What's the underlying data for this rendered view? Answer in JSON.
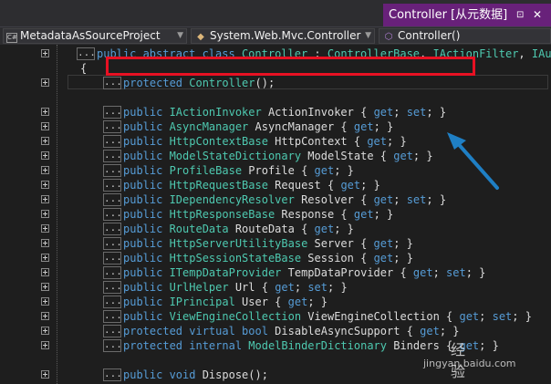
{
  "tab": {
    "title": "Controller [从元数据]",
    "pin_glyph": "⊡",
    "close_glyph": "✕"
  },
  "navbar": {
    "project": "MetadataAsSourceProject",
    "class": "System.Web.Mvc.Controller",
    "member": "Controller()"
  },
  "code_lines": [
    {
      "fold": true,
      "ell": true,
      "parts": [
        [
          "kw",
          "public abstract class "
        ],
        [
          "ty",
          "Controller"
        ],
        [
          "pl",
          " : "
        ],
        [
          "ty",
          "ControllerBase"
        ],
        [
          "pl",
          ", "
        ],
        [
          "ty",
          "IActionFilter"
        ],
        [
          "pl",
          ", "
        ],
        [
          "ty",
          "IAuth"
        ]
      ]
    },
    {
      "fold": false,
      "ell": false,
      "parts": [
        [
          "pl",
          "{"
        ]
      ]
    },
    {
      "fold": true,
      "ell": true,
      "parts": [
        [
          "kw",
          "protected "
        ],
        [
          "ty",
          "Controller"
        ],
        [
          "pl",
          "();"
        ]
      ]
    },
    {
      "fold": false,
      "ell": false,
      "parts": []
    },
    {
      "fold": true,
      "ell": true,
      "parts": [
        [
          "kw",
          "public "
        ],
        [
          "ty",
          "IActionInvoker"
        ],
        [
          "pl",
          " ActionInvoker { "
        ],
        [
          "kw",
          "get"
        ],
        [
          "pl",
          "; "
        ],
        [
          "kw",
          "set"
        ],
        [
          "pl",
          "; }"
        ]
      ]
    },
    {
      "fold": true,
      "ell": true,
      "parts": [
        [
          "kw",
          "public "
        ],
        [
          "ty",
          "AsyncManager"
        ],
        [
          "pl",
          " AsyncManager { "
        ],
        [
          "kw",
          "get"
        ],
        [
          "pl",
          "; }"
        ]
      ]
    },
    {
      "fold": true,
      "ell": true,
      "parts": [
        [
          "kw",
          "public "
        ],
        [
          "ty",
          "HttpContextBase"
        ],
        [
          "pl",
          " HttpContext { "
        ],
        [
          "kw",
          "get"
        ],
        [
          "pl",
          "; }"
        ]
      ]
    },
    {
      "fold": true,
      "ell": true,
      "parts": [
        [
          "kw",
          "public "
        ],
        [
          "ty",
          "ModelStateDictionary"
        ],
        [
          "pl",
          " ModelState { "
        ],
        [
          "kw",
          "get"
        ],
        [
          "pl",
          "; }"
        ]
      ]
    },
    {
      "fold": true,
      "ell": true,
      "parts": [
        [
          "kw",
          "public "
        ],
        [
          "ty",
          "ProfileBase"
        ],
        [
          "pl",
          " Profile { "
        ],
        [
          "kw",
          "get"
        ],
        [
          "pl",
          "; }"
        ]
      ]
    },
    {
      "fold": true,
      "ell": true,
      "parts": [
        [
          "kw",
          "public "
        ],
        [
          "ty",
          "HttpRequestBase"
        ],
        [
          "pl",
          " Request { "
        ],
        [
          "kw",
          "get"
        ],
        [
          "pl",
          "; }"
        ]
      ]
    },
    {
      "fold": true,
      "ell": true,
      "parts": [
        [
          "kw",
          "public "
        ],
        [
          "ty",
          "IDependencyResolver"
        ],
        [
          "pl",
          " Resolver { "
        ],
        [
          "kw",
          "get"
        ],
        [
          "pl",
          "; "
        ],
        [
          "kw",
          "set"
        ],
        [
          "pl",
          "; }"
        ]
      ]
    },
    {
      "fold": true,
      "ell": true,
      "parts": [
        [
          "kw",
          "public "
        ],
        [
          "ty",
          "HttpResponseBase"
        ],
        [
          "pl",
          " Response { "
        ],
        [
          "kw",
          "get"
        ],
        [
          "pl",
          "; }"
        ]
      ]
    },
    {
      "fold": true,
      "ell": true,
      "parts": [
        [
          "kw",
          "public "
        ],
        [
          "ty",
          "RouteData"
        ],
        [
          "pl",
          " RouteData { "
        ],
        [
          "kw",
          "get"
        ],
        [
          "pl",
          "; }"
        ]
      ]
    },
    {
      "fold": true,
      "ell": true,
      "parts": [
        [
          "kw",
          "public "
        ],
        [
          "ty",
          "HttpServerUtilityBase"
        ],
        [
          "pl",
          " Server { "
        ],
        [
          "kw",
          "get"
        ],
        [
          "pl",
          "; }"
        ]
      ]
    },
    {
      "fold": true,
      "ell": true,
      "parts": [
        [
          "kw",
          "public "
        ],
        [
          "ty",
          "HttpSessionStateBase"
        ],
        [
          "pl",
          " Session { "
        ],
        [
          "kw",
          "get"
        ],
        [
          "pl",
          "; }"
        ]
      ]
    },
    {
      "fold": true,
      "ell": true,
      "parts": [
        [
          "kw",
          "public "
        ],
        [
          "ty",
          "ITempDataProvider"
        ],
        [
          "pl",
          " TempDataProvider { "
        ],
        [
          "kw",
          "get"
        ],
        [
          "pl",
          "; "
        ],
        [
          "kw",
          "set"
        ],
        [
          "pl",
          "; }"
        ]
      ]
    },
    {
      "fold": true,
      "ell": true,
      "parts": [
        [
          "kw",
          "public "
        ],
        [
          "ty",
          "UrlHelper"
        ],
        [
          "pl",
          " Url { "
        ],
        [
          "kw",
          "get"
        ],
        [
          "pl",
          "; "
        ],
        [
          "kw",
          "set"
        ],
        [
          "pl",
          "; }"
        ]
      ]
    },
    {
      "fold": true,
      "ell": true,
      "parts": [
        [
          "kw",
          "public "
        ],
        [
          "ty",
          "IPrincipal"
        ],
        [
          "pl",
          " User { "
        ],
        [
          "kw",
          "get"
        ],
        [
          "pl",
          "; }"
        ]
      ]
    },
    {
      "fold": true,
      "ell": true,
      "parts": [
        [
          "kw",
          "public "
        ],
        [
          "ty",
          "ViewEngineCollection"
        ],
        [
          "pl",
          " ViewEngineCollection { "
        ],
        [
          "kw",
          "get"
        ],
        [
          "pl",
          "; "
        ],
        [
          "kw",
          "set"
        ],
        [
          "pl",
          "; }"
        ]
      ]
    },
    {
      "fold": true,
      "ell": true,
      "parts": [
        [
          "kw",
          "protected virtual bool "
        ],
        [
          "pl",
          "DisableAsyncSupport { "
        ],
        [
          "kw",
          "get"
        ],
        [
          "pl",
          "; }"
        ]
      ]
    },
    {
      "fold": true,
      "ell": true,
      "parts": [
        [
          "kw",
          "protected internal "
        ],
        [
          "ty",
          "ModelBinderDictionary"
        ],
        [
          "pl",
          " Binders { "
        ],
        [
          "kw",
          "get"
        ],
        [
          "pl",
          "; }"
        ]
      ]
    },
    {
      "fold": false,
      "ell": false,
      "parts": []
    },
    {
      "fold": true,
      "ell": true,
      "parts": [
        [
          "kw",
          "public void "
        ],
        [
          "pl",
          "Dispose();"
        ]
      ]
    }
  ],
  "ellipsis_text": "...",
  "watermark": {
    "brand": "经验",
    "site": "jingyan.baidu.com"
  },
  "colors": {
    "accent": "#68217a",
    "keyword": "#569cd6",
    "type": "#4ec9b0",
    "highlight": "#e81123",
    "arrow": "#1f7fc4"
  }
}
